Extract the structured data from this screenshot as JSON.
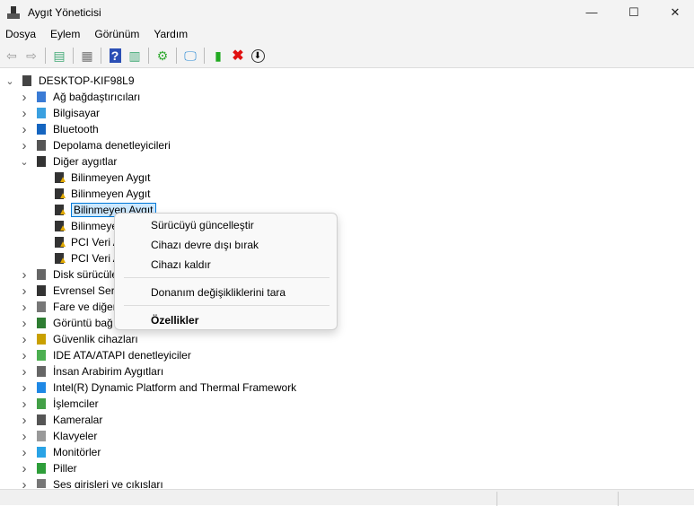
{
  "window": {
    "title": "Aygıt Yöneticisi",
    "minimize": "—",
    "maximize": "☐",
    "close": "✕"
  },
  "menu": [
    "Dosya",
    "Eylem",
    "Görünüm",
    "Yardım"
  ],
  "toolbar": [
    "back-icon",
    "forward-icon",
    "show-hide-console-tree-icon",
    "properties-icon",
    "help-icon",
    "action-pane-icon",
    "update-driver-icon",
    "scan-hardware-icon",
    "enable-device-icon",
    "uninstall-device-icon",
    "disable-device-icon"
  ],
  "tree": {
    "root": "DESKTOP-KIF98L9",
    "categories": [
      {
        "label": "Ağ bağdaştırıcıları",
        "icon": "network-adapter-icon",
        "color": "#3a7bd5"
      },
      {
        "label": "Bilgisayar",
        "icon": "computer-icon",
        "color": "#3aa0e0"
      },
      {
        "label": "Bluetooth",
        "icon": "bluetooth-icon",
        "color": "#1565c0"
      },
      {
        "label": "Depolama denetleyicileri",
        "icon": "storage-controller-icon",
        "color": "#555555"
      },
      {
        "label": "Diğer aygıtlar",
        "icon": "other-devices-icon",
        "color": "#333333",
        "expanded": true
      }
    ],
    "other_devices": [
      "Bilinmeyen Aygıt",
      "Bilinmeyen Aygıt",
      "Bilinmeyen Aygıt",
      "Bilinmeyen Aygıt",
      "PCI Veri A",
      "PCI Veri A"
    ],
    "categories_after": [
      {
        "label": "Disk sürücüle",
        "icon": "disk-drive-icon",
        "color": "#666666"
      },
      {
        "label": "Evrensel Seri",
        "icon": "usb-icon",
        "color": "#333333"
      },
      {
        "label": "Fare ve diğer",
        "icon": "mouse-icon",
        "color": "#777777"
      },
      {
        "label": "Görüntü bağ",
        "icon": "display-adapter-icon",
        "color": "#2e7d32"
      },
      {
        "label": "Güvenlik cihazları",
        "icon": "security-device-icon",
        "color": "#c9a000"
      },
      {
        "label": "IDE ATA/ATAPI denetleyiciler",
        "icon": "ide-icon",
        "color": "#4caf50"
      },
      {
        "label": "İnsan Arabirim Aygıtları",
        "icon": "hid-icon",
        "color": "#666666"
      },
      {
        "label": "Intel(R) Dynamic Platform and Thermal Framework",
        "icon": "intel-dptf-icon",
        "color": "#1e88e5"
      },
      {
        "label": "İşlemciler",
        "icon": "processor-icon",
        "color": "#43a047"
      },
      {
        "label": "Kameralar",
        "icon": "camera-icon",
        "color": "#555555"
      },
      {
        "label": "Klavyeler",
        "icon": "keyboard-icon",
        "color": "#999999"
      },
      {
        "label": "Monitörler",
        "icon": "monitor-icon",
        "color": "#29a3e6"
      },
      {
        "label": "Piller",
        "icon": "battery-icon",
        "color": "#2e9e3a"
      },
      {
        "label": "Ses girişleri ve çıkışları",
        "icon": "audio-icon",
        "color": "#777777"
      }
    ]
  },
  "context_menu": {
    "items": [
      "Sürücüyü güncelleştir",
      "Cihazı devre dışı bırak",
      "Cihazı kaldır",
      "Donanım değişikliklerini tara",
      "Özellikler"
    ]
  }
}
